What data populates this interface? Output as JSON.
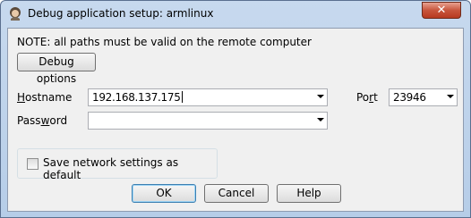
{
  "window": {
    "title": "Debug application setup: armlinux",
    "close_glyph": "✕"
  },
  "note": "NOTE: all paths must be valid on the remote computer",
  "debug_options_button": "Debug options",
  "hostname": {
    "label_prefix": "",
    "label_underlined": "H",
    "label_rest": "ostname",
    "value": "192.168.137.175"
  },
  "port": {
    "label_prefix": "Po",
    "label_underlined": "r",
    "label_rest": "t",
    "value": "23946"
  },
  "password": {
    "label_prefix": "Pass",
    "label_underlined": "w",
    "label_rest": "ord",
    "value": ""
  },
  "save_checkbox": {
    "label": "Save network settings as default",
    "checked": false
  },
  "buttons": {
    "ok": "OK",
    "cancel": "Cancel",
    "help": "Help"
  }
}
